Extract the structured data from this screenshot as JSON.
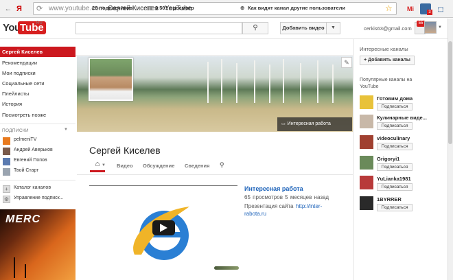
{
  "browser": {
    "yandex_glyph": "Я",
    "url_host": "www.youtube.com",
    "url_sep": "›",
    "tab_title": "Сергей Киселев - YouTube",
    "ext_mi": "Mi",
    "ext_badge": "3",
    "star": "☆"
  },
  "header": {
    "logo_you": "You",
    "logo_tube": "Tube",
    "logo_ru": "RU",
    "search_placeholder": "",
    "search_icon": "search-icon",
    "upload_label": "Добавить видео",
    "user_email": "cerkis63@gmail.com",
    "notifications": "55"
  },
  "sidebar": {
    "items": [
      {
        "label": "Сергей Киселев",
        "active": true
      },
      {
        "label": "Рекомендации"
      },
      {
        "label": "Мои подписки"
      },
      {
        "label": "Социальные сети"
      },
      {
        "label": "Плейлисты"
      },
      {
        "label": "История"
      },
      {
        "label": "Посмотреть позже"
      }
    ],
    "subs_title": "ПОДПИСКИ",
    "subscriptions": [
      {
        "label": "pelmeniTV",
        "color": "#e87a1e"
      },
      {
        "label": "Андрей Аверьков",
        "color": "#7a5a4a"
      },
      {
        "label": "Евгений Попов",
        "color": "#5a7ab0"
      },
      {
        "label": "Твой Старт",
        "color": "#9aa4b0"
      }
    ],
    "tools": [
      {
        "label": "Каталог каналов"
      },
      {
        "label": "Управление подписк..."
      }
    ],
    "promo_text": "MERC"
  },
  "stats": {
    "subscribers": "28 подписчиков",
    "views": "9 591 просмотр",
    "viewer_link": "Как видят канал другие пользователи"
  },
  "banner": {
    "link_label": "Интересная работа"
  },
  "channel": {
    "title": "Сергей Киселев",
    "tabs": [
      "Видео",
      "Обсуждение",
      "Сведения"
    ]
  },
  "featured": {
    "title": "Интересная работа",
    "views": "65 просмотров",
    "age": "5 месяцев назад",
    "desc_prefix": "Презентация сайта",
    "desc_link_a": "http://inter-",
    "desc_link_b": "rabota.ru"
  },
  "right": {
    "interesting_title": "Интересные каналы",
    "add_channels": "+ Добавить каналы",
    "popular_title": "Популярные каналы на YouTube",
    "subscribe_label": "Подписаться",
    "channels": [
      {
        "name": "Готовим дома",
        "color": "#e8c23a"
      },
      {
        "name": "Кулинарные виде...",
        "color": "#c8b8a8"
      },
      {
        "name": "videoculinary",
        "color": "#a04030"
      },
      {
        "name": "Grigoryi1",
        "color": "#6a8a5a"
      },
      {
        "name": "YuLianka1981",
        "color": "#b83a3a"
      },
      {
        "name": "1BYRRER",
        "color": "#2a2a2a"
      }
    ]
  }
}
